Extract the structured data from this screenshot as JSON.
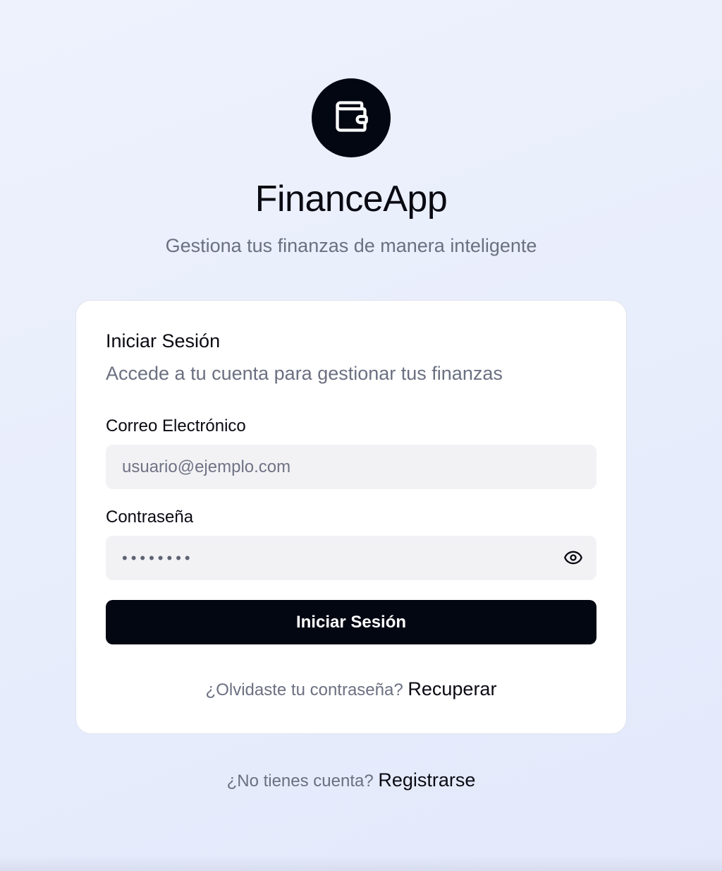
{
  "brand": {
    "name": "FinanceApp",
    "tagline": "Gestiona tus finanzas de manera inteligente",
    "logo_icon": "wallet-icon",
    "logo_bg": "#030712"
  },
  "login_card": {
    "title": "Iniciar Sesión",
    "description": "Accede a tu cuenta para gestionar tus finanzas",
    "email": {
      "label": "Correo Electrónico",
      "placeholder": "usuario@ejemplo.com",
      "value": ""
    },
    "password": {
      "label": "Contraseña",
      "masked_value": "••••••••",
      "toggle_icon": "eye-icon"
    },
    "submit_label": "Iniciar Sesión",
    "forgot_prompt": "¿Olvidaste tu contraseña?",
    "forgot_link": "Recuperar"
  },
  "footer": {
    "register_prompt": "¿No tienes cuenta?",
    "register_link": "Registrarse"
  },
  "colors": {
    "primary": "#030712",
    "muted_text": "#6b7081",
    "input_bg": "#f2f2f5",
    "card_bg": "#ffffff"
  }
}
